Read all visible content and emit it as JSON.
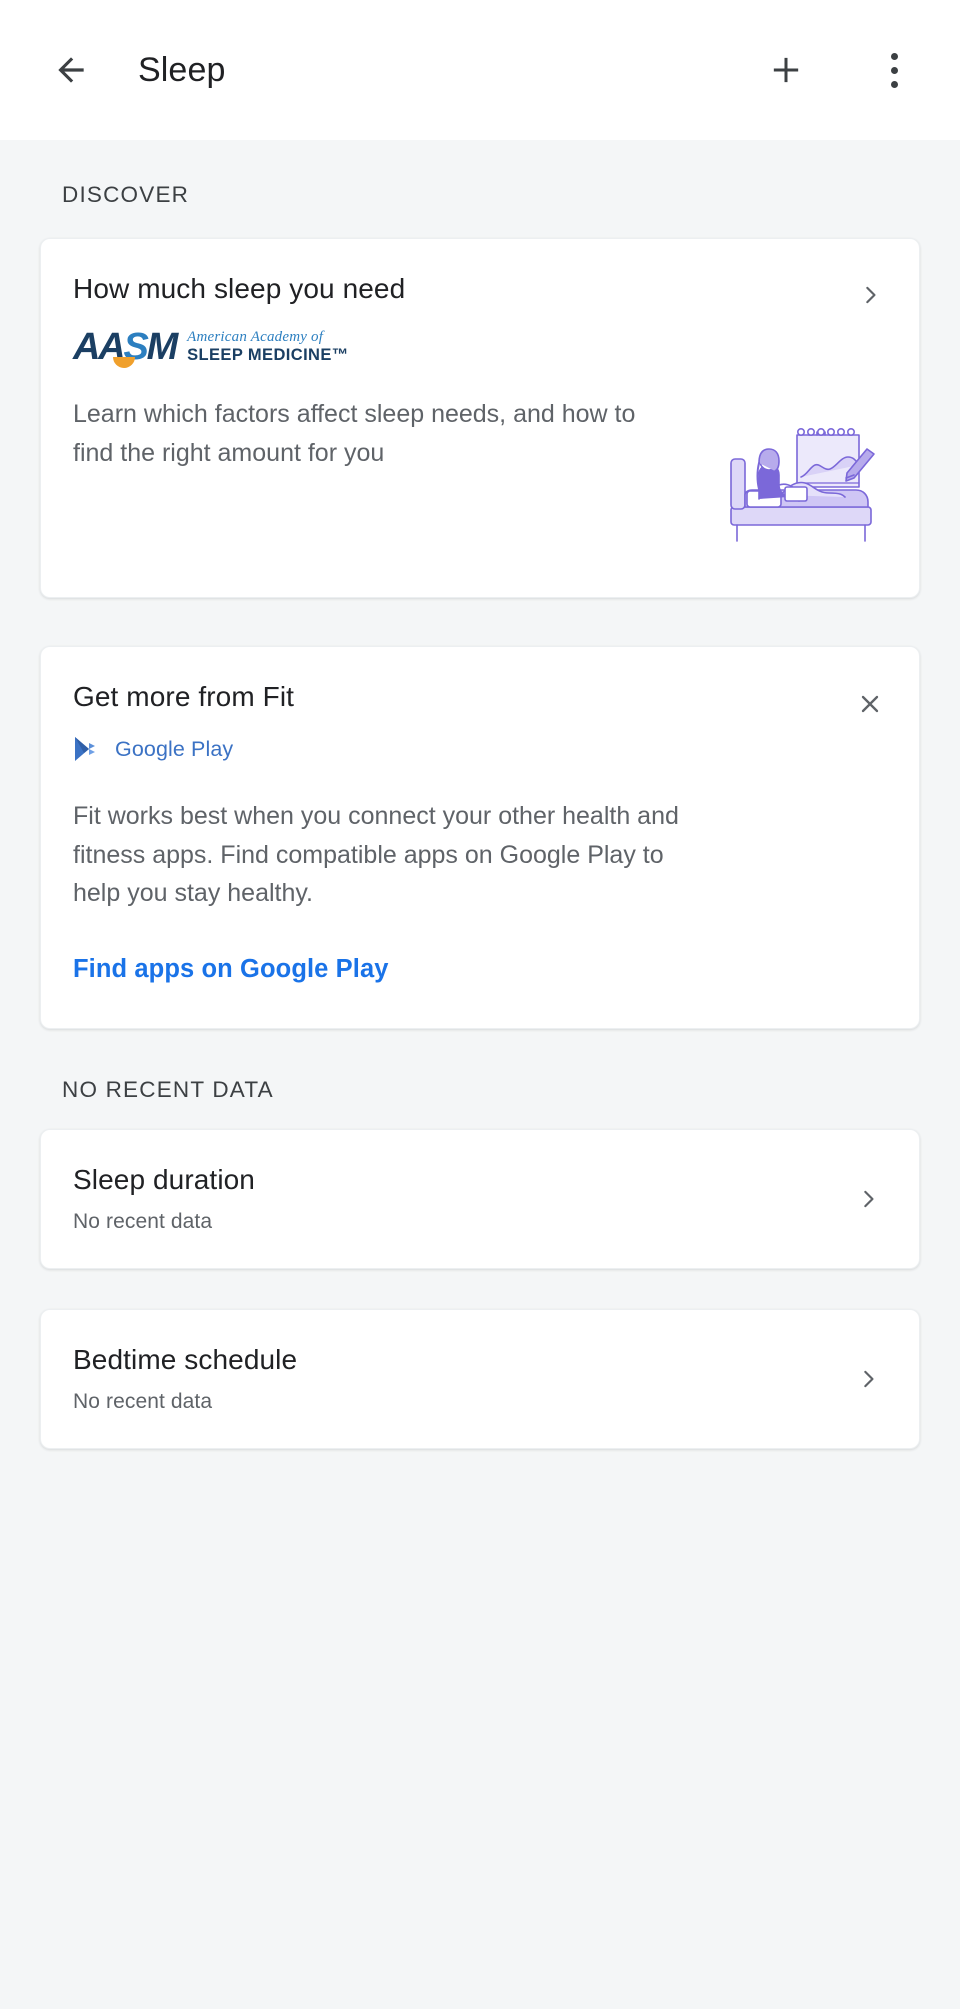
{
  "appbar": {
    "back_icon": "arrow-left-icon",
    "title": "Sleep",
    "add_icon": "plus-icon",
    "overflow_icon": "more-vert-icon"
  },
  "sections": [
    {
      "id": "discover",
      "header": "DISCOVER"
    },
    {
      "id": "no_recent_data",
      "header": "NO RECENT DATA"
    }
  ],
  "discover_card": {
    "title": "How much sleep you need",
    "chevron_icon": "chevron-right-icon",
    "logo": {
      "mark_a": "AA",
      "mark_s": "S",
      "mark_m": "M",
      "line1": "American Academy of",
      "line2": "SLEEP MEDICINE™"
    },
    "body": "Learn which factors affect sleep needs, and how to find the right amount for you",
    "illustration": "person-in-bed-illustration"
  },
  "promo_card": {
    "title": "Get more from Fit",
    "close_icon": "close-icon",
    "source_icon": "google-play-icon",
    "source_label": "Google Play",
    "body": "Fit works best when you connect your other health and fitness apps. Find compatible apps on Google Play to help you stay healthy.",
    "link_label": "Find apps on Google Play"
  },
  "data_cards": [
    {
      "title": "Sleep duration",
      "subtitle": "No recent data",
      "chevron_icon": "chevron-right-icon"
    },
    {
      "title": "Bedtime schedule",
      "subtitle": "No recent data",
      "chevron_icon": "chevron-right-icon"
    }
  ],
  "colors": {
    "background": "#f4f6f7",
    "card": "#ffffff",
    "primary_text": "#202124",
    "secondary_text": "#5f6368",
    "link_blue": "#1a73e8",
    "play_blue": "#3b72c4",
    "aasm_navy": "#1b3f63",
    "aasm_blue": "#2c7fc0",
    "aasm_orange": "#f0a02c",
    "illustration_purple": "#7b68d9"
  }
}
